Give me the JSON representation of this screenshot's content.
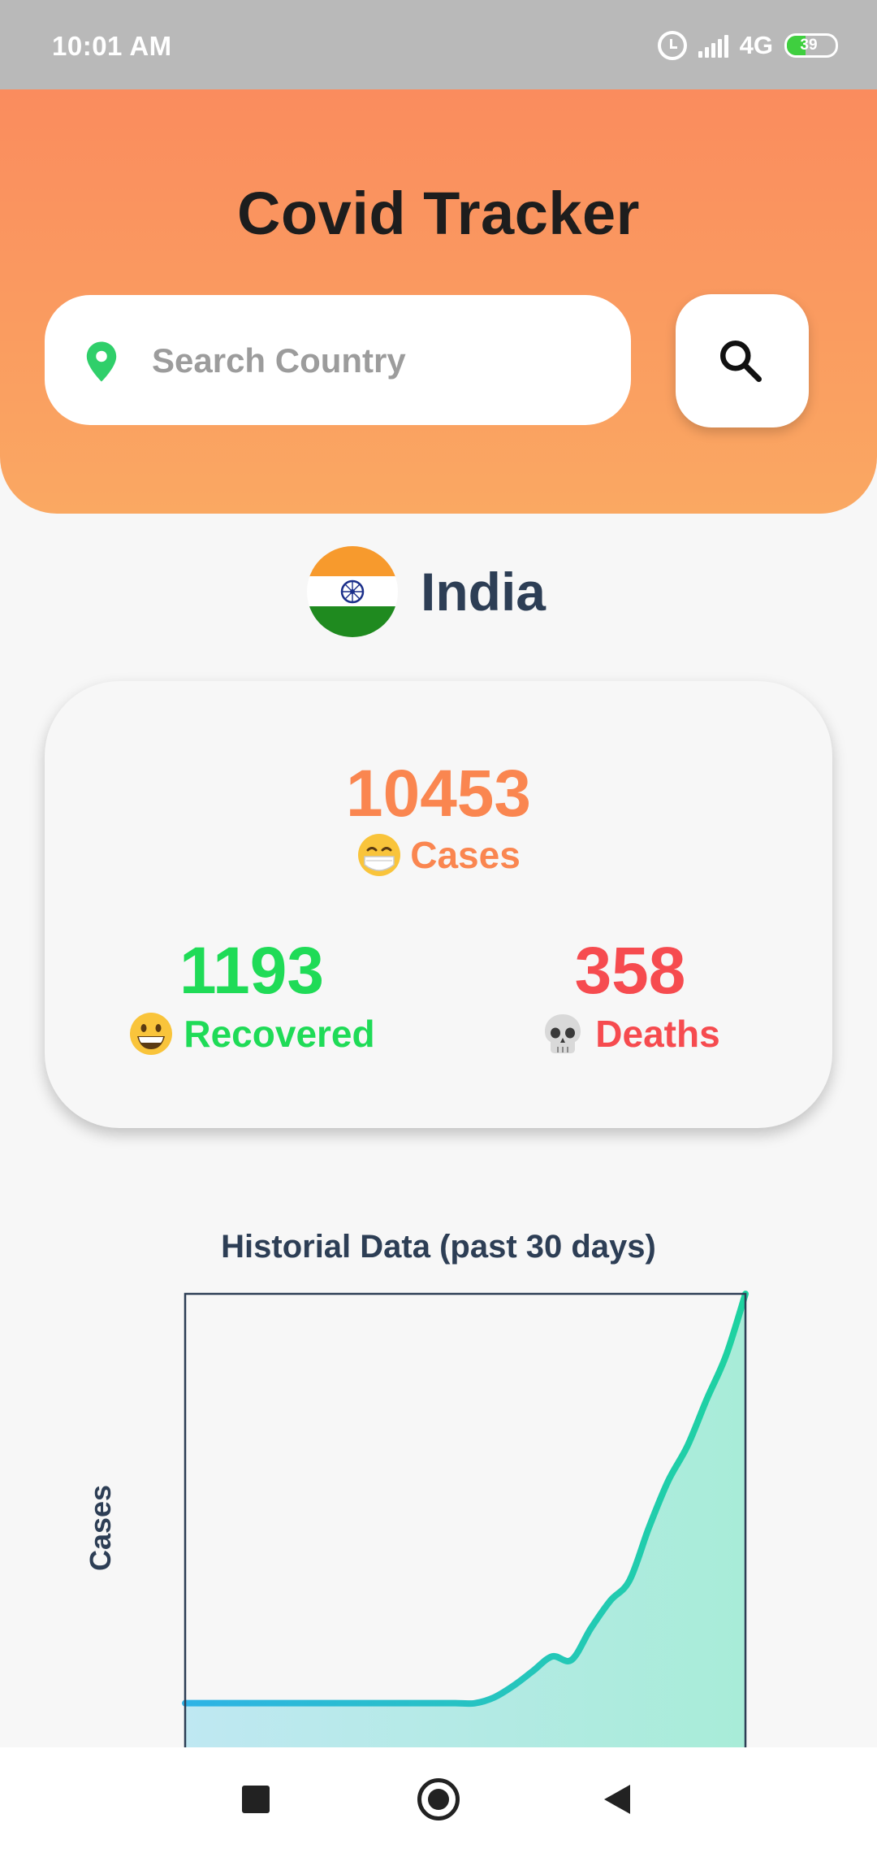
{
  "status_bar": {
    "time": "10:01 AM",
    "network": "4G",
    "battery_level": "39",
    "battery_fraction": 0.39
  },
  "header": {
    "title": "Covid Tracker",
    "search": {
      "placeholder": "Search Country",
      "value": "",
      "location_icon": "map-pin-icon",
      "button_icon": "magnifier-icon"
    }
  },
  "country": {
    "name": "India",
    "flag_icon": "india-flag-icon"
  },
  "stats": {
    "cases": {
      "value": "10453",
      "label": "Cases",
      "icon": "face-with-mask-emoji",
      "color": "#fa8650"
    },
    "recovered": {
      "value": "1193",
      "label": "Recovered",
      "icon": "grinning-face-emoji",
      "color": "#1fdb57"
    },
    "deaths": {
      "value": "358",
      "label": "Deaths",
      "icon": "skull-emoji",
      "color": "#f64b4f"
    }
  },
  "chart_data": {
    "type": "area",
    "title": "Historial Data (past 30 days)",
    "ylabel": "Cases",
    "xlabel": "",
    "grid": false,
    "legend": "none",
    "values": [
      0,
      0,
      0,
      0,
      0,
      0,
      0,
      0,
      0,
      0,
      0,
      0,
      0,
      0,
      0,
      0,
      10,
      30,
      55,
      80,
      74,
      128,
      175,
      210,
      300,
      380,
      440,
      520,
      595,
      700
    ],
    "ylim": [
      -120,
      700
    ],
    "colors": {
      "line_start": "#2fb3e6",
      "line_end": "#1ed2a0",
      "fill_start": "#bfe8f2",
      "fill_end": "#a8ecd8",
      "axis": "#2d3e55"
    }
  },
  "nav": {
    "recents_icon": "square-icon",
    "home_icon": "circle-home-icon",
    "back_icon": "triangle-back-icon"
  }
}
